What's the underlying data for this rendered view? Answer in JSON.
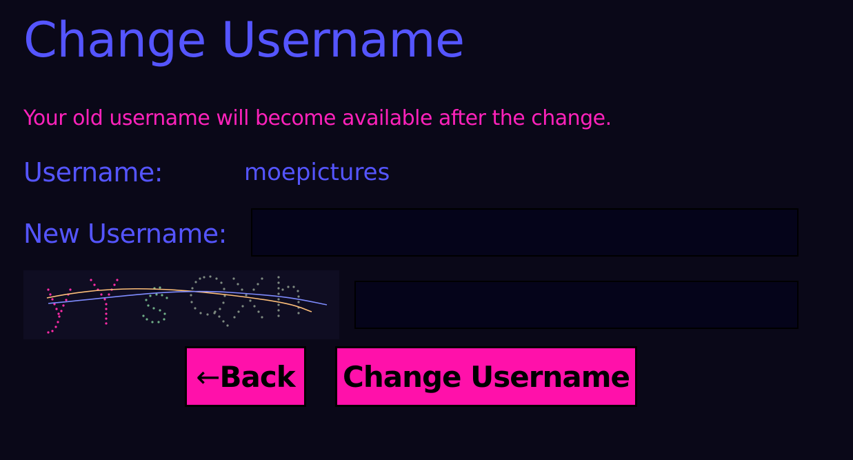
{
  "page": {
    "title": "Change Username",
    "notice": "Your old username will become available after the change."
  },
  "form": {
    "username_label": "Username:",
    "username_value": "moepictures",
    "new_username_label": "New Username:",
    "new_username_value": "",
    "captcha_value": "",
    "captcha_image_alt": "captcha",
    "captcha_text": "yYsQXh"
  },
  "buttons": {
    "back_arrow": "←",
    "back_label": "Back",
    "submit_label": "Change Username"
  },
  "colors": {
    "background": "#0a0818",
    "heading": "#5555ff",
    "notice": "#ff22bb",
    "button": "#ff11aa",
    "input_background": "#05041a"
  }
}
